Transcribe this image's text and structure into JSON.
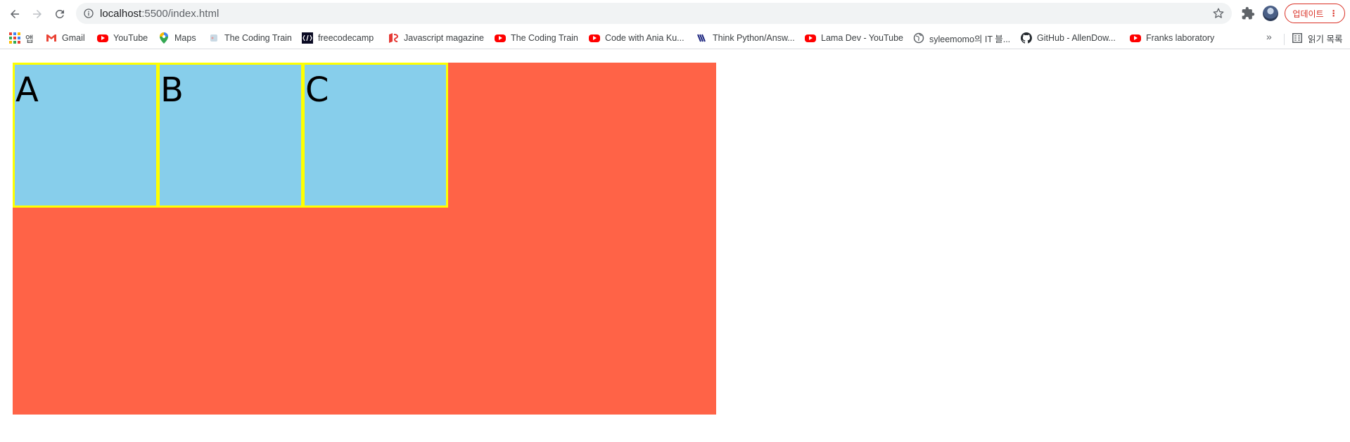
{
  "browser": {
    "url_host": "localhost",
    "url_path": ":5500/index.html",
    "update_label": "업데이트",
    "more_bookmarks_label": "»",
    "reading_list_label": "읽기 목록"
  },
  "bookmarks": [
    {
      "label": "앱",
      "icon": "apps-grid-icon"
    },
    {
      "label": "Gmail",
      "icon": "gmail-icon"
    },
    {
      "label": "YouTube",
      "icon": "youtube-icon"
    },
    {
      "label": "Maps",
      "icon": "maps-icon"
    },
    {
      "label": "The Coding Train",
      "icon": "coding-train-icon"
    },
    {
      "label": "freecodecamp",
      "icon": "freecodecamp-icon"
    },
    {
      "label": "Javascript magazine",
      "icon": "js-magazine-icon"
    },
    {
      "label": "The Coding Train",
      "icon": "youtube-icon"
    },
    {
      "label": "Code with Ania Ku...",
      "icon": "youtube-icon"
    },
    {
      "label": "Think Python/Answ...",
      "icon": "book-icon"
    },
    {
      "label": "Lama Dev - YouTube",
      "icon": "youtube-icon"
    },
    {
      "label": "syleemomo의 IT 블...",
      "icon": "globe-icon"
    },
    {
      "label": "GitHub - AllenDow...",
      "icon": "github-icon"
    },
    {
      "label": "Franks laboratory",
      "icon": "youtube-icon"
    }
  ],
  "page": {
    "boxes": [
      "A",
      "B",
      "C"
    ],
    "colors": {
      "container": "#ff6347",
      "box_fill": "#87ceeb",
      "box_border": "#ffff00"
    }
  }
}
